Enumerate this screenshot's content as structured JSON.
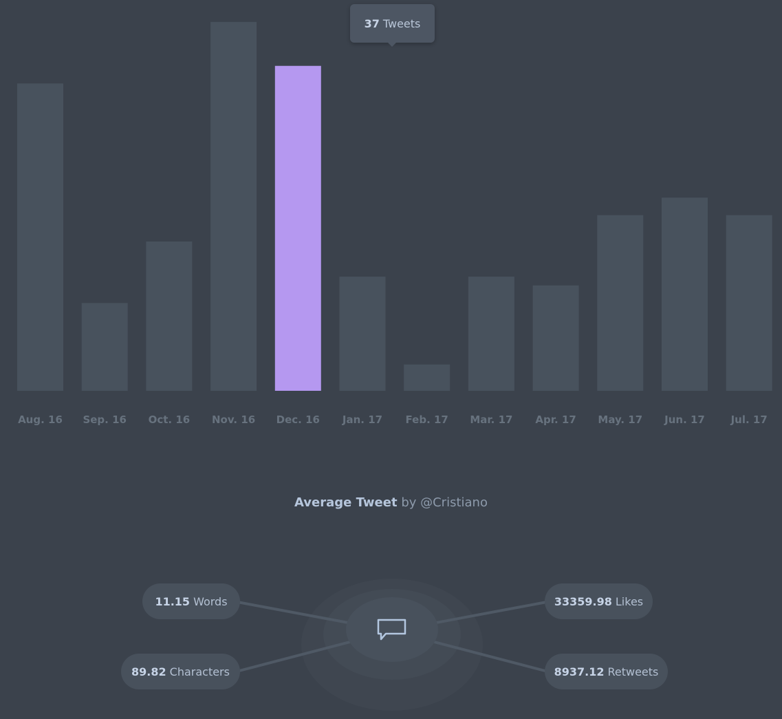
{
  "chart_data": {
    "type": "bar",
    "categories": [
      "Aug. 16",
      "Sep. 16",
      "Oct. 16",
      "Nov. 16",
      "Dec. 16",
      "Jan. 17",
      "Feb. 17",
      "Mar. 17",
      "Apr. 17",
      "May. 17",
      "Jun. 17",
      "Jul. 17"
    ],
    "values": [
      35,
      10,
      17,
      42,
      37,
      13,
      3,
      13,
      12,
      20,
      22,
      20
    ],
    "ylim": [
      0,
      44.5
    ],
    "highlighted_index": 4,
    "grid": false,
    "colors": {
      "bar": "#48525d",
      "highlight": "#b598f0",
      "background": "#3b424c"
    }
  },
  "tooltip": {
    "value": "37",
    "unit": "Tweets"
  },
  "average": {
    "title_bold": "Average Tweet",
    "title_rest": "by @Cristiano",
    "icon": "speech-bubble-icon",
    "stats": [
      {
        "value": "11.15",
        "label": "Words"
      },
      {
        "value": "89.82",
        "label": "Characters"
      },
      {
        "value": "33359.98",
        "label": "Likes"
      },
      {
        "value": "8937.12",
        "label": "Retweets"
      }
    ]
  }
}
